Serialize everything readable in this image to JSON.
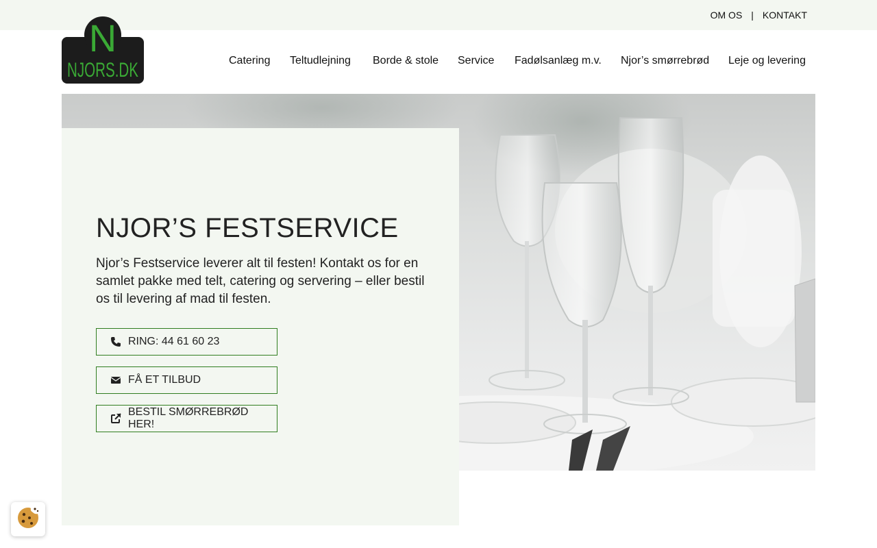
{
  "topbar": {
    "links": [
      "OM OS",
      "KONTAKT"
    ],
    "separator": "|"
  },
  "logo": {
    "letter": "N",
    "text": "NJORS.DK"
  },
  "nav": {
    "items": [
      "Catering",
      "Teltudlejning",
      "Borde & stole",
      "Service",
      "Fadølsanlæg m.v.",
      "Njor’s smørrebrød",
      "Leje og levering"
    ]
  },
  "hero": {
    "title": "NJOR’S FESTSERVICE",
    "text": "Njor’s Festservice leverer alt til festen! Kontakt os for en samlet pakke med telt, catering og servering – eller bestil os til levering af mad til festen.",
    "buttons": [
      {
        "label": "RING: 44 61 60 23",
        "icon": "phone-icon"
      },
      {
        "label": "FÅ ET TILBUD",
        "icon": "envelope-icon"
      },
      {
        "label": "BESTIL SMØRREBRØD HER!",
        "icon": "external-link-icon"
      }
    ]
  },
  "colors": {
    "accent": "#2f7d1f",
    "panel": "#f3f7f1",
    "logo_green": "#3aa935",
    "logo_bg": "#1c1c1c"
  }
}
